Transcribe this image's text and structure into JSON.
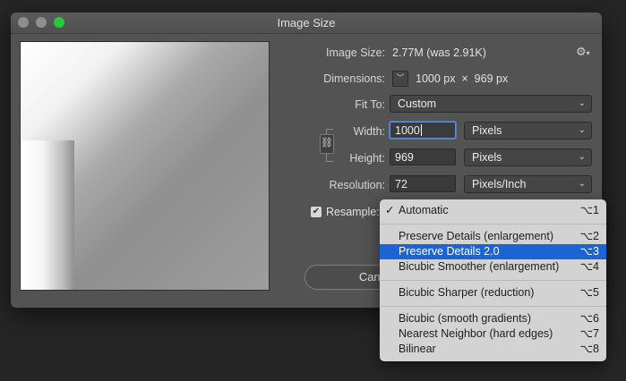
{
  "window": {
    "title": "Image Size"
  },
  "info": {
    "image_size_label": "Image Size:",
    "image_size_value": "2.77M (was 2.91K)",
    "dimensions_label": "Dimensions:",
    "dimensions_value": "1000 px  ×  969 px",
    "fit_to_label": "Fit To:",
    "fit_to_value": "Custom",
    "width_label": "Width:",
    "width_value": "1000",
    "width_unit": "Pixels",
    "height_label": "Height:",
    "height_value": "969",
    "height_unit": "Pixels",
    "resolution_label": "Resolution:",
    "resolution_value": "72",
    "resolution_unit": "Pixels/Inch",
    "resample_label": "Resample:",
    "resample_checked": true
  },
  "buttons": {
    "cancel": "Canc"
  },
  "icons": {
    "gear": "gear-icon",
    "chain": "link-icon",
    "dropdown": "chevron-down-icon",
    "checkmark": "checkmark-icon"
  },
  "resample_menu": {
    "items": [
      {
        "label": "Automatic",
        "shortcut": "⌥1",
        "checked": true
      },
      {
        "label": "Preserve Details (enlargement)",
        "shortcut": "⌥2"
      },
      {
        "label": "Preserve Details 2.0",
        "shortcut": "⌥3",
        "highlighted": true
      },
      {
        "label": "Bicubic Smoother (enlargement)",
        "shortcut": "⌥4"
      },
      {
        "label": "Bicubic Sharper (reduction)",
        "shortcut": "⌥5"
      },
      {
        "label": "Bicubic (smooth gradients)",
        "shortcut": "⌥6"
      },
      {
        "label": "Nearest Neighbor (hard edges)",
        "shortcut": "⌥7"
      },
      {
        "label": "Bilinear",
        "shortcut": "⌥8"
      }
    ]
  },
  "colors": {
    "highlight": "#1c64d3",
    "focus_ring": "#5b8fd6",
    "window_bg": "#535353"
  }
}
